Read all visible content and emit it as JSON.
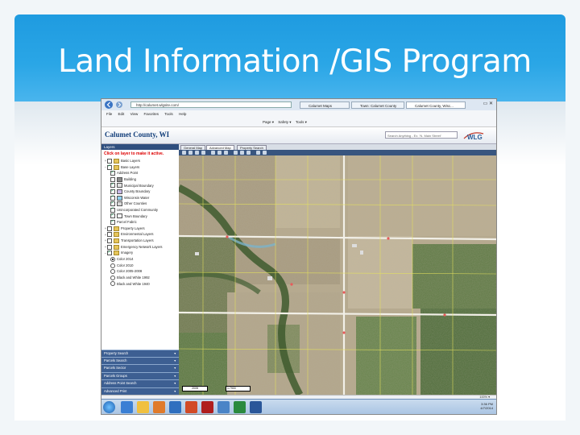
{
  "slide": {
    "title": "Land Information /GIS Program"
  },
  "browser": {
    "address": "http://calumet.wlgsite.com/",
    "tabs": [
      "Calumet Maps",
      "Town: Calumet County",
      "Calumet County, Wisc..."
    ],
    "menu": [
      "File",
      "Edit",
      "View",
      "Favorites",
      "Tools",
      "Help"
    ],
    "commands": [
      "Page ▾",
      "Safety ▾",
      "Tools ▾"
    ],
    "status": "100% ▾"
  },
  "app": {
    "title": "Calumet County, WI",
    "search_placeholder": "Search Anything - Ex. 'N. Main Street'",
    "logo": "WLG",
    "map_tabs": [
      "General Map",
      "Advanced Map",
      "Property Search"
    ],
    "panel_header": "Layers",
    "panel_hint": "Click on layer to make it active.",
    "layers": [
      {
        "label": "Basic Layers",
        "kind": "folder",
        "indent": 0,
        "checked": false,
        "expander": "+"
      },
      {
        "label": "Base Layers",
        "kind": "folder",
        "indent": 0,
        "checked": true,
        "expander": "−"
      },
      {
        "label": "Address Point",
        "kind": "check",
        "indent": 1,
        "checked": true
      },
      {
        "label": "Building",
        "kind": "swatch",
        "indent": 1,
        "checked": false,
        "swatch": "#8a8a8a"
      },
      {
        "label": "Municipal Boundary",
        "kind": "swatch",
        "indent": 1,
        "checked": true,
        "swatch": "#e0e0e0"
      },
      {
        "label": "County Boundary",
        "kind": "swatch",
        "indent": 1,
        "checked": true,
        "swatch": "#c7b9e6"
      },
      {
        "label": "Wisconsin Water",
        "kind": "swatch",
        "indent": 1,
        "checked": true,
        "swatch": "#8fd0ef"
      },
      {
        "label": "Other Counties",
        "kind": "swatch",
        "indent": 1,
        "checked": true,
        "swatch": "#d8d8d8"
      },
      {
        "label": "Unincorporated Community",
        "kind": "check",
        "indent": 1,
        "checked": true
      },
      {
        "label": "Town Boundary",
        "kind": "swatch",
        "indent": 1,
        "checked": true,
        "swatch": "#f3f3f3"
      },
      {
        "label": "Parcel Fabric",
        "kind": "check",
        "indent": 1,
        "checked": true
      },
      {
        "label": "Property Layers",
        "kind": "folder",
        "indent": 0,
        "checked": false,
        "expander": "+"
      },
      {
        "label": "Environmental Layers",
        "kind": "folder",
        "indent": 0,
        "checked": false,
        "expander": "+"
      },
      {
        "label": "Transportation Layers",
        "kind": "folder",
        "indent": 0,
        "checked": false,
        "expander": "+"
      },
      {
        "label": "Emergency Network Layers",
        "kind": "folder",
        "indent": 0,
        "checked": false,
        "expander": "+"
      },
      {
        "label": "Imagery",
        "kind": "folder",
        "indent": 0,
        "checked": true,
        "expander": "−"
      },
      {
        "label": "Color 2014",
        "kind": "radio",
        "indent": 1,
        "checked": true
      },
      {
        "label": "Color 2010",
        "kind": "radio",
        "indent": 1,
        "checked": false
      },
      {
        "label": "Color 2005-2008",
        "kind": "radio",
        "indent": 1,
        "checked": false
      },
      {
        "label": "Black and White 1992",
        "kind": "radio",
        "indent": 1,
        "checked": false
      },
      {
        "label": "Black and White 1940",
        "kind": "radio",
        "indent": 1,
        "checked": false
      }
    ],
    "accordion": [
      "Property Search",
      "Parcels Search",
      "Parcels Sector",
      "Parcels Groups",
      "Address Point Search",
      "Advanced Print"
    ],
    "scale_label": "200ft",
    "zoom_value": "1:7900"
  },
  "taskbar": {
    "time": "3:36 PM",
    "date": "4/7/2014"
  },
  "colors": {
    "slide_blue": "#2aa6e6",
    "panel_blue": "#3d5f92",
    "road": "#f2f0e8",
    "parcel_line": "#e6e35c"
  }
}
